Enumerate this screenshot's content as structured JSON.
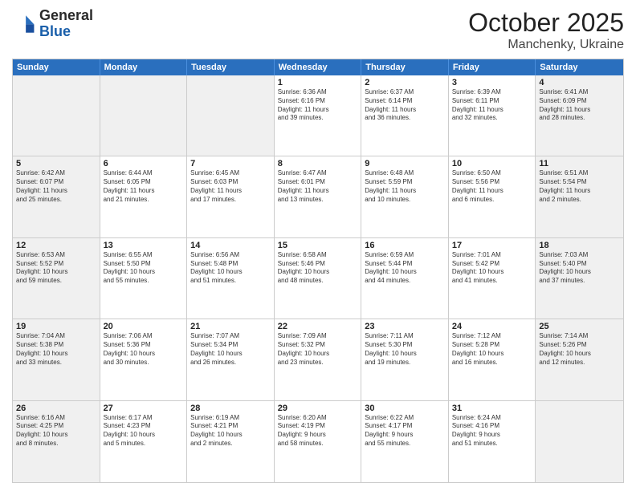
{
  "header": {
    "logo_general": "General",
    "logo_blue": "Blue",
    "month": "October 2025",
    "location": "Manchenky, Ukraine"
  },
  "weekdays": [
    "Sunday",
    "Monday",
    "Tuesday",
    "Wednesday",
    "Thursday",
    "Friday",
    "Saturday"
  ],
  "weeks": [
    [
      {
        "day": "",
        "info": "",
        "shaded": true
      },
      {
        "day": "",
        "info": "",
        "shaded": true
      },
      {
        "day": "",
        "info": "",
        "shaded": true
      },
      {
        "day": "1",
        "info": "Sunrise: 6:36 AM\nSunset: 6:16 PM\nDaylight: 11 hours\nand 39 minutes.",
        "shaded": false
      },
      {
        "day": "2",
        "info": "Sunrise: 6:37 AM\nSunset: 6:14 PM\nDaylight: 11 hours\nand 36 minutes.",
        "shaded": false
      },
      {
        "day": "3",
        "info": "Sunrise: 6:39 AM\nSunset: 6:11 PM\nDaylight: 11 hours\nand 32 minutes.",
        "shaded": false
      },
      {
        "day": "4",
        "info": "Sunrise: 6:41 AM\nSunset: 6:09 PM\nDaylight: 11 hours\nand 28 minutes.",
        "shaded": true
      }
    ],
    [
      {
        "day": "5",
        "info": "Sunrise: 6:42 AM\nSunset: 6:07 PM\nDaylight: 11 hours\nand 25 minutes.",
        "shaded": true
      },
      {
        "day": "6",
        "info": "Sunrise: 6:44 AM\nSunset: 6:05 PM\nDaylight: 11 hours\nand 21 minutes.",
        "shaded": false
      },
      {
        "day": "7",
        "info": "Sunrise: 6:45 AM\nSunset: 6:03 PM\nDaylight: 11 hours\nand 17 minutes.",
        "shaded": false
      },
      {
        "day": "8",
        "info": "Sunrise: 6:47 AM\nSunset: 6:01 PM\nDaylight: 11 hours\nand 13 minutes.",
        "shaded": false
      },
      {
        "day": "9",
        "info": "Sunrise: 6:48 AM\nSunset: 5:59 PM\nDaylight: 11 hours\nand 10 minutes.",
        "shaded": false
      },
      {
        "day": "10",
        "info": "Sunrise: 6:50 AM\nSunset: 5:56 PM\nDaylight: 11 hours\nand 6 minutes.",
        "shaded": false
      },
      {
        "day": "11",
        "info": "Sunrise: 6:51 AM\nSunset: 5:54 PM\nDaylight: 11 hours\nand 2 minutes.",
        "shaded": true
      }
    ],
    [
      {
        "day": "12",
        "info": "Sunrise: 6:53 AM\nSunset: 5:52 PM\nDaylight: 10 hours\nand 59 minutes.",
        "shaded": true
      },
      {
        "day": "13",
        "info": "Sunrise: 6:55 AM\nSunset: 5:50 PM\nDaylight: 10 hours\nand 55 minutes.",
        "shaded": false
      },
      {
        "day": "14",
        "info": "Sunrise: 6:56 AM\nSunset: 5:48 PM\nDaylight: 10 hours\nand 51 minutes.",
        "shaded": false
      },
      {
        "day": "15",
        "info": "Sunrise: 6:58 AM\nSunset: 5:46 PM\nDaylight: 10 hours\nand 48 minutes.",
        "shaded": false
      },
      {
        "day": "16",
        "info": "Sunrise: 6:59 AM\nSunset: 5:44 PM\nDaylight: 10 hours\nand 44 minutes.",
        "shaded": false
      },
      {
        "day": "17",
        "info": "Sunrise: 7:01 AM\nSunset: 5:42 PM\nDaylight: 10 hours\nand 41 minutes.",
        "shaded": false
      },
      {
        "day": "18",
        "info": "Sunrise: 7:03 AM\nSunset: 5:40 PM\nDaylight: 10 hours\nand 37 minutes.",
        "shaded": true
      }
    ],
    [
      {
        "day": "19",
        "info": "Sunrise: 7:04 AM\nSunset: 5:38 PM\nDaylight: 10 hours\nand 33 minutes.",
        "shaded": true
      },
      {
        "day": "20",
        "info": "Sunrise: 7:06 AM\nSunset: 5:36 PM\nDaylight: 10 hours\nand 30 minutes.",
        "shaded": false
      },
      {
        "day": "21",
        "info": "Sunrise: 7:07 AM\nSunset: 5:34 PM\nDaylight: 10 hours\nand 26 minutes.",
        "shaded": false
      },
      {
        "day": "22",
        "info": "Sunrise: 7:09 AM\nSunset: 5:32 PM\nDaylight: 10 hours\nand 23 minutes.",
        "shaded": false
      },
      {
        "day": "23",
        "info": "Sunrise: 7:11 AM\nSunset: 5:30 PM\nDaylight: 10 hours\nand 19 minutes.",
        "shaded": false
      },
      {
        "day": "24",
        "info": "Sunrise: 7:12 AM\nSunset: 5:28 PM\nDaylight: 10 hours\nand 16 minutes.",
        "shaded": false
      },
      {
        "day": "25",
        "info": "Sunrise: 7:14 AM\nSunset: 5:26 PM\nDaylight: 10 hours\nand 12 minutes.",
        "shaded": true
      }
    ],
    [
      {
        "day": "26",
        "info": "Sunrise: 6:16 AM\nSunset: 4:25 PM\nDaylight: 10 hours\nand 8 minutes.",
        "shaded": true
      },
      {
        "day": "27",
        "info": "Sunrise: 6:17 AM\nSunset: 4:23 PM\nDaylight: 10 hours\nand 5 minutes.",
        "shaded": false
      },
      {
        "day": "28",
        "info": "Sunrise: 6:19 AM\nSunset: 4:21 PM\nDaylight: 10 hours\nand 2 minutes.",
        "shaded": false
      },
      {
        "day": "29",
        "info": "Sunrise: 6:20 AM\nSunset: 4:19 PM\nDaylight: 9 hours\nand 58 minutes.",
        "shaded": false
      },
      {
        "day": "30",
        "info": "Sunrise: 6:22 AM\nSunset: 4:17 PM\nDaylight: 9 hours\nand 55 minutes.",
        "shaded": false
      },
      {
        "day": "31",
        "info": "Sunrise: 6:24 AM\nSunset: 4:16 PM\nDaylight: 9 hours\nand 51 minutes.",
        "shaded": false
      },
      {
        "day": "",
        "info": "",
        "shaded": true
      }
    ]
  ]
}
